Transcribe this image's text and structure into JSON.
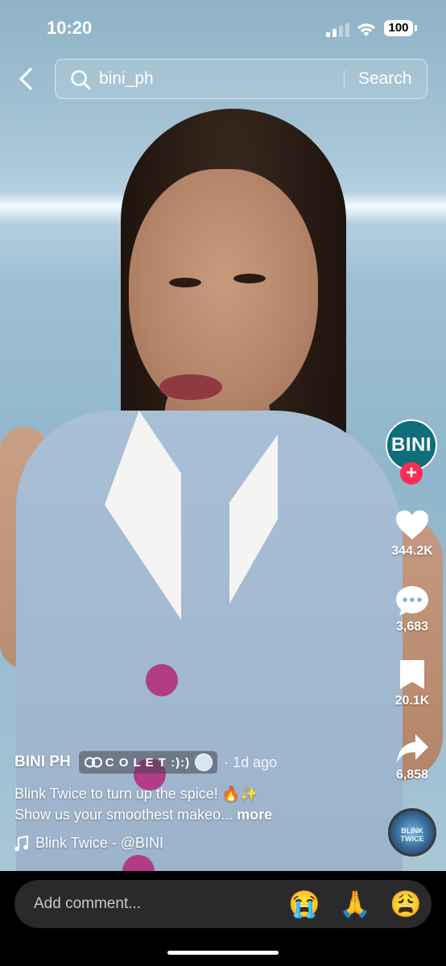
{
  "status_bar": {
    "time": "10:20",
    "battery": "100"
  },
  "search": {
    "query": "bini_ph",
    "button_label": "Search"
  },
  "creator": {
    "avatar_text": "BINI",
    "follow_symbol": "+"
  },
  "actions": {
    "likes": "344.2K",
    "comments": "3,683",
    "saves": "20.1K",
    "shares": "6,858"
  },
  "sound_disc": {
    "label": "BLINK TWICE"
  },
  "post": {
    "author": "BINI PH",
    "effect_name": "C O L E T :):)",
    "time_ago": "· 1d ago",
    "caption_line1": "Blink Twice to turn up the spice! 🔥✨",
    "caption_line2": "Show us your smoothest makeo...",
    "more_label": "more",
    "music": "Blink Twice - @BINI"
  },
  "comment_bar": {
    "placeholder": "Add comment...",
    "emojis": [
      "😭",
      "🙏",
      "😩"
    ]
  },
  "colors": {
    "follow": "#fe2c55",
    "avatar_bg": "#0e6f7a"
  }
}
